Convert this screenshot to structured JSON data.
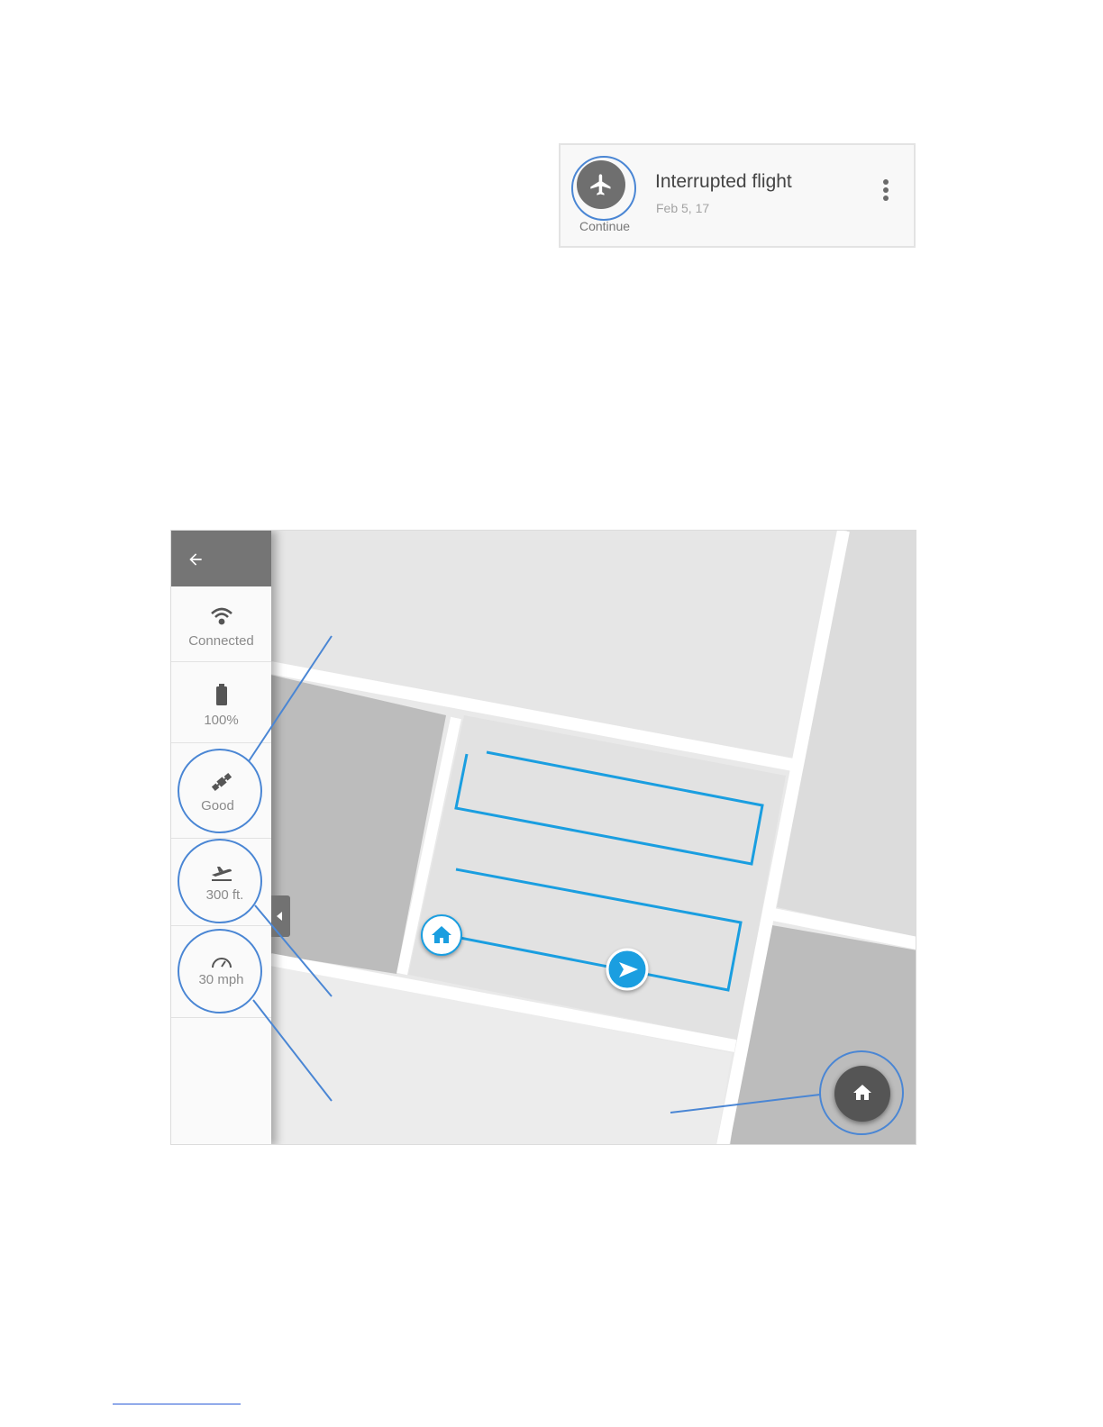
{
  "flight_card": {
    "title": "Interrupted flight",
    "date": "Feb 5, 17",
    "continue_label": "Continue",
    "action_icon": "airplane-icon",
    "menu_icon": "more-vert-icon"
  },
  "sidebar": {
    "back_icon": "back-arrow-icon",
    "items": [
      {
        "icon": "wifi-icon",
        "label": "Connected"
      },
      {
        "icon": "battery-icon",
        "label": "100%"
      },
      {
        "icon": "satellite-icon",
        "label": "Good"
      },
      {
        "icon": "takeoff-icon",
        "label": "300 ft."
      },
      {
        "icon": "speedometer-icon",
        "label": "30 mph"
      }
    ]
  },
  "map": {
    "flight_path_color": "#1a9ee0",
    "home_marker_icon": "home-icon",
    "drone_marker_icon": "navigation-arrow-icon",
    "return_home_button_icon": "home-icon"
  },
  "colors": {
    "annotation": "#4a86d4",
    "sidebar_header": "#757575",
    "map_road": "#ffffff",
    "map_block_dark": "#bcbcbc",
    "map_block_light": "#e0e0e0"
  }
}
